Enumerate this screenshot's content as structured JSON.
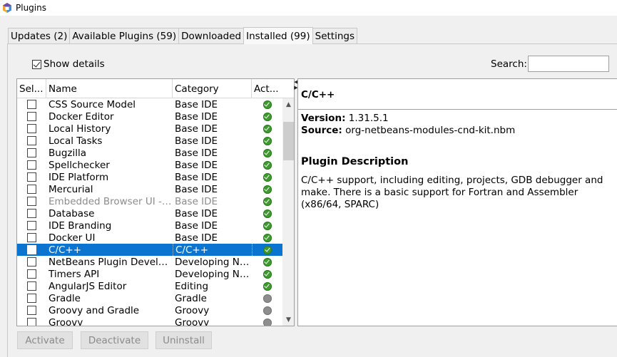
{
  "window": {
    "title": "Plugins"
  },
  "tabs": [
    {
      "label": "Updates (2)",
      "active": false
    },
    {
      "label": "Available Plugins (59)",
      "active": false
    },
    {
      "label": "Downloaded",
      "active": false
    },
    {
      "label": "Installed (99)",
      "active": true
    },
    {
      "label": "Settings",
      "active": false
    }
  ],
  "toolbar": {
    "show_details_label": "Show details",
    "show_details_checked": true,
    "search_label": "Search:",
    "search_value": ""
  },
  "table": {
    "columns": {
      "select": "Sel...",
      "name": "Name",
      "category": "Category",
      "active": "Act..."
    },
    "rows": [
      {
        "name": "CSS Source Model",
        "category": "Base IDE",
        "status": "active"
      },
      {
        "name": "Docker Editor",
        "category": "Base IDE",
        "status": "active"
      },
      {
        "name": "Local History",
        "category": "Base IDE",
        "status": "active"
      },
      {
        "name": "Local Tasks",
        "category": "Base IDE",
        "status": "active"
      },
      {
        "name": "Bugzilla",
        "category": "Base IDE",
        "status": "active"
      },
      {
        "name": "Spellchecker",
        "category": "Base IDE",
        "status": "active"
      },
      {
        "name": "IDE Platform",
        "category": "Base IDE",
        "status": "active"
      },
      {
        "name": "Mercurial",
        "category": "Base IDE",
        "status": "active"
      },
      {
        "name": "Embedded Browser UI - Ja...",
        "category": "Base IDE",
        "status": "active",
        "disabled": true
      },
      {
        "name": "Database",
        "category": "Base IDE",
        "status": "active"
      },
      {
        "name": "IDE Branding",
        "category": "Base IDE",
        "status": "active"
      },
      {
        "name": "Docker UI",
        "category": "Base IDE",
        "status": "active"
      },
      {
        "name": "C/C++",
        "category": "C/C++",
        "status": "active",
        "selected": true
      },
      {
        "name": "NetBeans Plugin Developm...",
        "category": "Developing Net...",
        "status": "active"
      },
      {
        "name": "Timers API",
        "category": "Developing Net...",
        "status": "active"
      },
      {
        "name": "AngularJS Editor",
        "category": "Editing",
        "status": "active"
      },
      {
        "name": "Gradle",
        "category": "Gradle",
        "status": "inactive"
      },
      {
        "name": "Groovy and Gradle",
        "category": "Groovy",
        "status": "inactive"
      },
      {
        "name": "Groovy",
        "category": "Groovy",
        "status": "inactive"
      }
    ]
  },
  "details": {
    "title": "C/C++",
    "version_label": "Version:",
    "version_value": "1.31.5.1",
    "source_label": "Source:",
    "source_value": "org-netbeans-modules-cnd-kit.nbm",
    "description_heading": "Plugin Description",
    "description": "C/C++ support, including editing, projects, GDB debugger and make. There is a basic support for Fortran and Assembler (x86/64, SPARC)"
  },
  "buttons": {
    "activate": "Activate",
    "deactivate": "Deactivate",
    "uninstall": "Uninstall"
  },
  "colors": {
    "selection": "#0a74d0",
    "status_active": "#3f9b2f",
    "status_inactive": "#8e8e8e"
  }
}
